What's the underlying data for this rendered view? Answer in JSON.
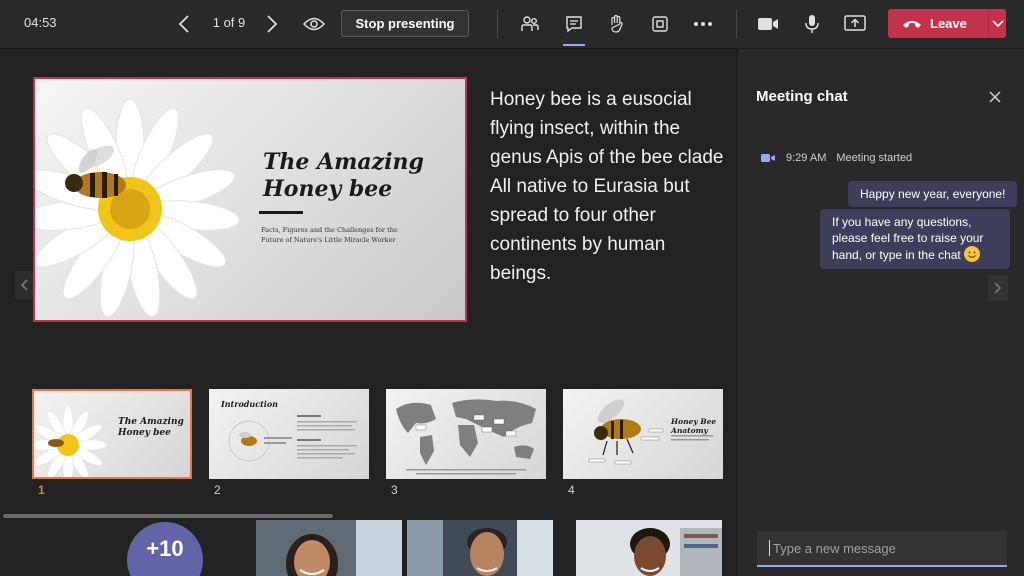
{
  "topbar": {
    "timer": "04:53",
    "slide_counter": "1 of 9",
    "stop_presenting_label": "Stop presenting",
    "leave_label": "Leave",
    "leave_color": "#c4314b",
    "icons": [
      "people-icon",
      "chat-icon",
      "reactions-icon",
      "rooms-icon",
      "more-icon",
      "camera-icon",
      "mic-icon",
      "share-icon"
    ]
  },
  "slide": {
    "title_line1": "The Amazing",
    "title_line2": "Honey bee",
    "subtitle": "Facts, Figures and the Challenges for the Future of Nature's Little Miracle Worker"
  },
  "notes": {
    "paragraph1": "Honey bee is a eusocial flying insect, within the genus Apis of the bee clade",
    "paragraph2": "All native to Eurasia but spread to four other continents by human beings."
  },
  "thumbnails": [
    {
      "number": "1",
      "title_line1": "The Amazing",
      "title_line2": "Honey bee",
      "selected": true
    },
    {
      "number": "2",
      "title": "Introduction",
      "selected": false
    },
    {
      "number": "3",
      "title": "",
      "selected": false
    },
    {
      "number": "4",
      "title_line1": "Honey Bee",
      "title_line2": "Anatomy",
      "selected": false
    }
  ],
  "participants": {
    "overflow_count": "+10",
    "overflow_color": "#6264a7"
  },
  "chat": {
    "title": "Meeting chat",
    "system_time": "9:29 AM",
    "system_text": "Meeting started",
    "messages": [
      {
        "text": "Happy new year, everyone!"
      },
      {
        "text_line1": "If you have any questions,",
        "text_line2": "please feel free to raise your",
        "text_line3": "hand, or type in the chat"
      }
    ],
    "compose_placeholder": "Type a new message",
    "accent": "#9ea2ff"
  }
}
